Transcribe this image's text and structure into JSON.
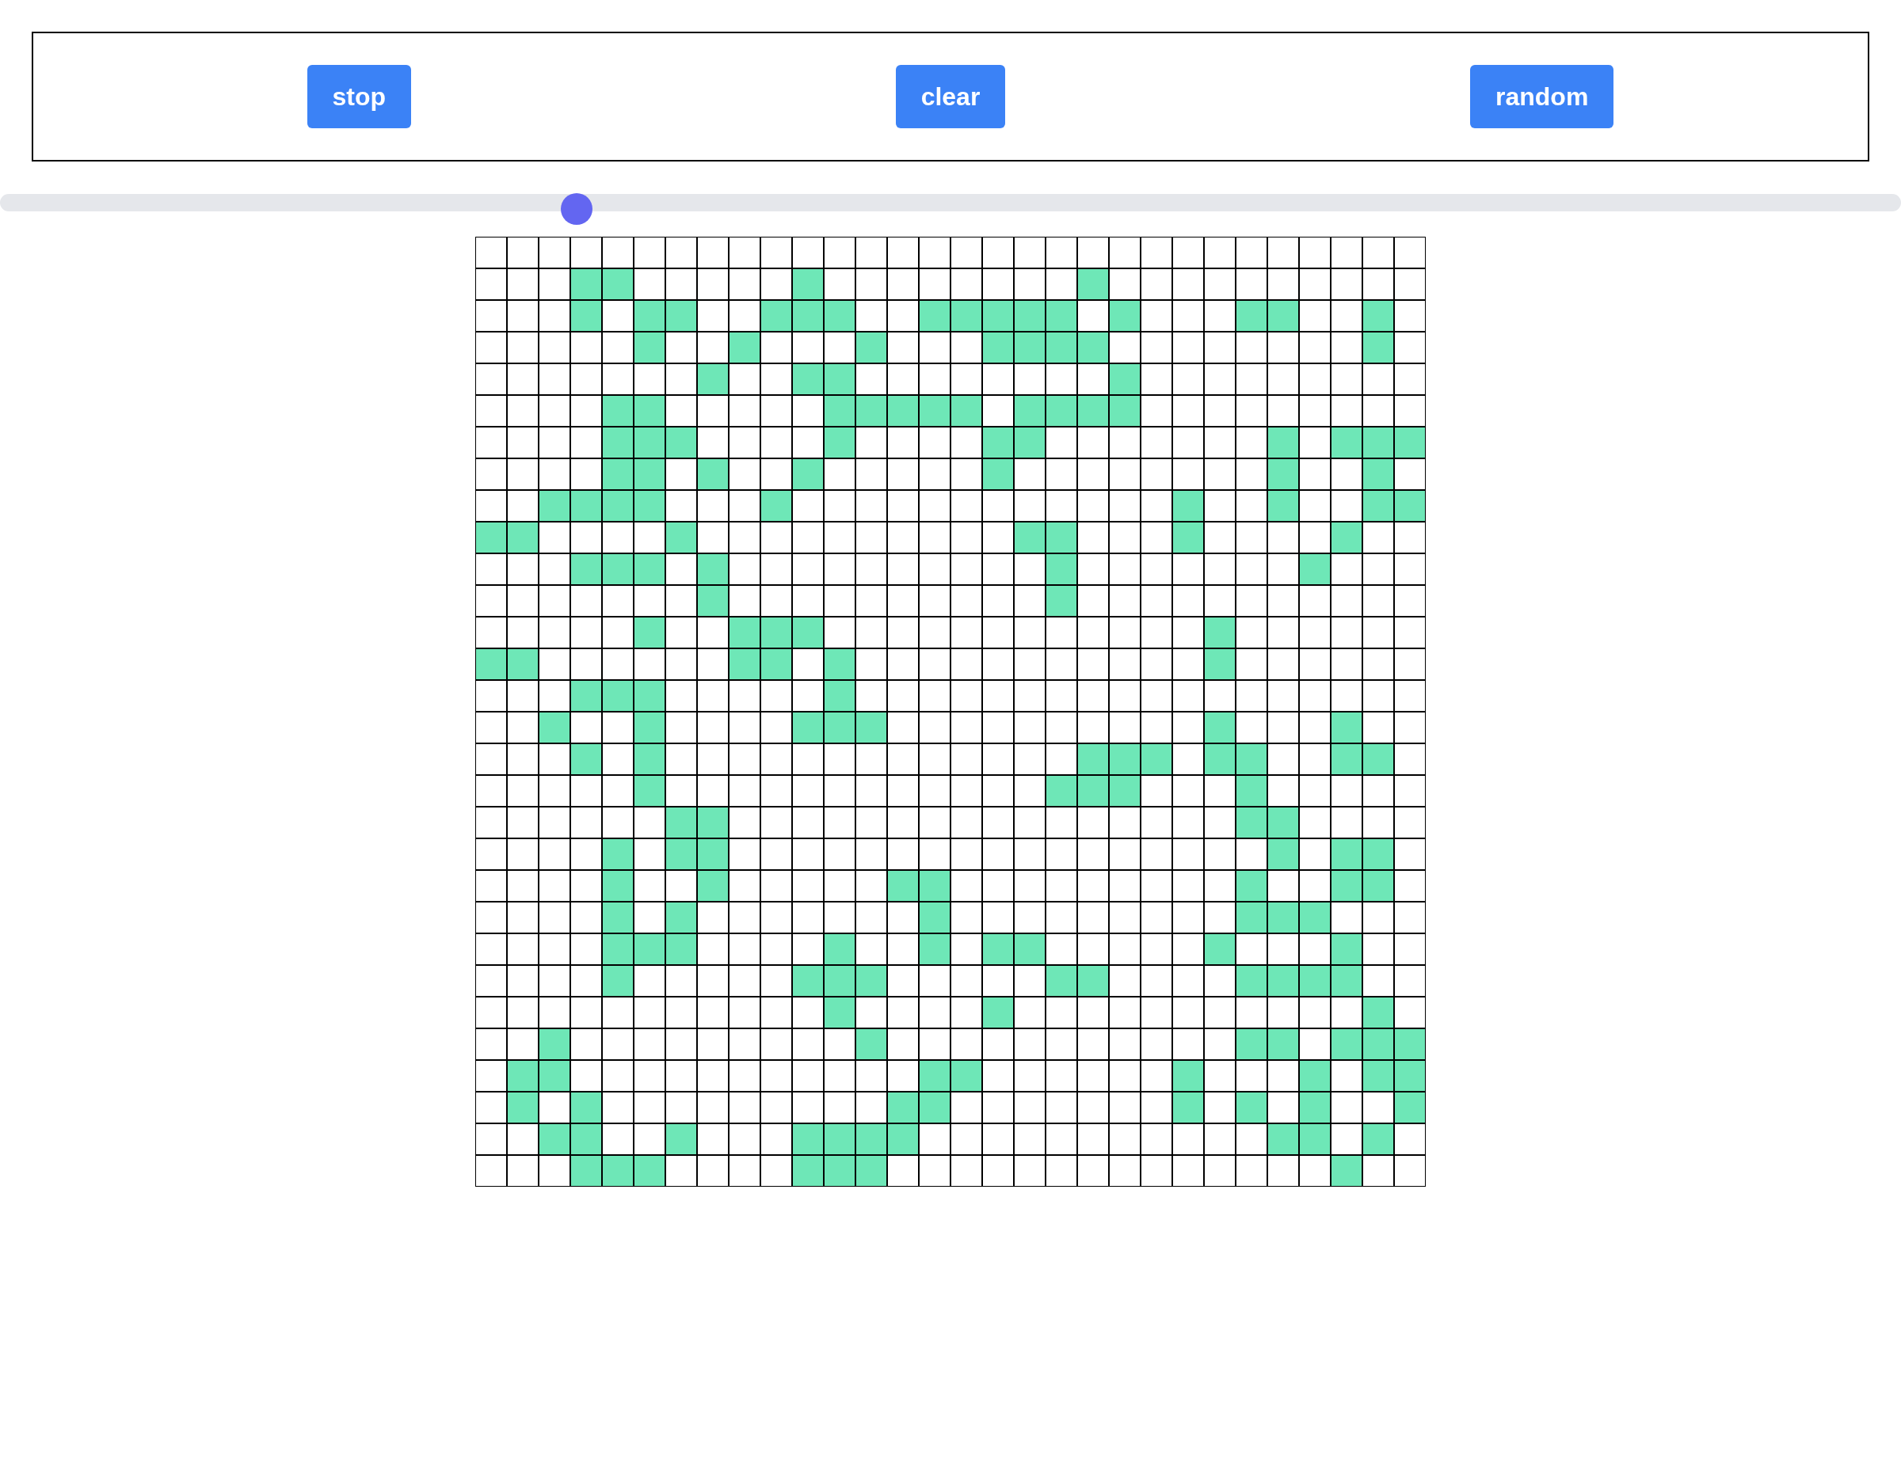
{
  "buttons": [
    {
      "label": "stop"
    },
    {
      "label": "clear"
    },
    {
      "label": "random"
    }
  ],
  "slider": {
    "level": 0.3
  },
  "grid": {
    "alive": [
      [
        false,
        false,
        false,
        false,
        false,
        false,
        false,
        false,
        false,
        false,
        false,
        false,
        false,
        false,
        false,
        false,
        false,
        false,
        false,
        false,
        false,
        false,
        false,
        false,
        false,
        false,
        false,
        false,
        false,
        false
      ],
      [
        false,
        false,
        false,
        true,
        true,
        false,
        false,
        false,
        false,
        false,
        true,
        false,
        false,
        false,
        false,
        false,
        false,
        false,
        false,
        true,
        false,
        false,
        false,
        false,
        false,
        false,
        false,
        false,
        false,
        false
      ],
      [
        false,
        false,
        false,
        true,
        false,
        true,
        true,
        false,
        false,
        true,
        true,
        true,
        false,
        false,
        true,
        true,
        true,
        true,
        true,
        false,
        true,
        false,
        false,
        false,
        true,
        true,
        false,
        false,
        true,
        false
      ],
      [
        false,
        false,
        false,
        false,
        false,
        true,
        false,
        false,
        true,
        false,
        false,
        false,
        true,
        false,
        false,
        false,
        true,
        true,
        true,
        true,
        false,
        false,
        false,
        false,
        false,
        false,
        false,
        false,
        true,
        false
      ],
      [
        false,
        false,
        false,
        false,
        false,
        false,
        false,
        true,
        false,
        false,
        true,
        true,
        false,
        false,
        false,
        false,
        false,
        false,
        false,
        false,
        true,
        false,
        false,
        false,
        false,
        false,
        false,
        false,
        false,
        false
      ],
      [
        false,
        false,
        false,
        false,
        true,
        true,
        false,
        false,
        false,
        false,
        false,
        true,
        true,
        true,
        true,
        true,
        false,
        true,
        true,
        true,
        true,
        false,
        false,
        false,
        false,
        false,
        false,
        false,
        false,
        false
      ],
      [
        false,
        false,
        false,
        false,
        true,
        true,
        true,
        false,
        false,
        false,
        false,
        true,
        false,
        false,
        false,
        false,
        true,
        true,
        false,
        false,
        false,
        false,
        false,
        false,
        false,
        true,
        false,
        true,
        true,
        true
      ],
      [
        false,
        false,
        false,
        false,
        true,
        true,
        false,
        true,
        false,
        false,
        true,
        false,
        false,
        false,
        false,
        false,
        true,
        false,
        false,
        false,
        false,
        false,
        false,
        false,
        false,
        true,
        false,
        false,
        true,
        false
      ],
      [
        false,
        false,
        true,
        true,
        true,
        true,
        false,
        false,
        false,
        true,
        false,
        false,
        false,
        false,
        false,
        false,
        false,
        false,
        false,
        false,
        false,
        false,
        true,
        false,
        false,
        true,
        false,
        false,
        true,
        true
      ],
      [
        true,
        true,
        false,
        false,
        false,
        false,
        true,
        false,
        false,
        false,
        false,
        false,
        false,
        false,
        false,
        false,
        false,
        true,
        true,
        false,
        false,
        false,
        true,
        false,
        false,
        false,
        false,
        true,
        false,
        false
      ],
      [
        false,
        false,
        false,
        true,
        true,
        true,
        false,
        true,
        false,
        false,
        false,
        false,
        false,
        false,
        false,
        false,
        false,
        false,
        true,
        false,
        false,
        false,
        false,
        false,
        false,
        false,
        true,
        false,
        false,
        false
      ],
      [
        false,
        false,
        false,
        false,
        false,
        false,
        false,
        true,
        false,
        false,
        false,
        false,
        false,
        false,
        false,
        false,
        false,
        false,
        true,
        false,
        false,
        false,
        false,
        false,
        false,
        false,
        false,
        false,
        false,
        false
      ],
      [
        false,
        false,
        false,
        false,
        false,
        true,
        false,
        false,
        true,
        true,
        true,
        false,
        false,
        false,
        false,
        false,
        false,
        false,
        false,
        false,
        false,
        false,
        false,
        true,
        false,
        false,
        false,
        false,
        false,
        false
      ],
      [
        true,
        true,
        false,
        false,
        false,
        false,
        false,
        false,
        true,
        true,
        false,
        true,
        false,
        false,
        false,
        false,
        false,
        false,
        false,
        false,
        false,
        false,
        false,
        true,
        false,
        false,
        false,
        false,
        false,
        false
      ],
      [
        false,
        false,
        false,
        true,
        true,
        true,
        false,
        false,
        false,
        false,
        false,
        true,
        false,
        false,
        false,
        false,
        false,
        false,
        false,
        false,
        false,
        false,
        false,
        false,
        false,
        false,
        false,
        false,
        false,
        false
      ],
      [
        false,
        false,
        true,
        false,
        false,
        true,
        false,
        false,
        false,
        false,
        true,
        true,
        true,
        false,
        false,
        false,
        false,
        false,
        false,
        false,
        false,
        false,
        false,
        true,
        false,
        false,
        false,
        true,
        false,
        false
      ],
      [
        false,
        false,
        false,
        true,
        false,
        true,
        false,
        false,
        false,
        false,
        false,
        false,
        false,
        false,
        false,
        false,
        false,
        false,
        false,
        true,
        true,
        true,
        false,
        true,
        true,
        false,
        false,
        true,
        true,
        false
      ],
      [
        false,
        false,
        false,
        false,
        false,
        true,
        false,
        false,
        false,
        false,
        false,
        false,
        false,
        false,
        false,
        false,
        false,
        false,
        true,
        true,
        true,
        false,
        false,
        false,
        true,
        false,
        false,
        false,
        false,
        false
      ],
      [
        false,
        false,
        false,
        false,
        false,
        false,
        true,
        true,
        false,
        false,
        false,
        false,
        false,
        false,
        false,
        false,
        false,
        false,
        false,
        false,
        false,
        false,
        false,
        false,
        true,
        true,
        false,
        false,
        false,
        false
      ],
      [
        false,
        false,
        false,
        false,
        true,
        false,
        true,
        true,
        false,
        false,
        false,
        false,
        false,
        false,
        false,
        false,
        false,
        false,
        false,
        false,
        false,
        false,
        false,
        false,
        false,
        true,
        false,
        true,
        true,
        false
      ],
      [
        false,
        false,
        false,
        false,
        true,
        false,
        false,
        true,
        false,
        false,
        false,
        false,
        false,
        true,
        true,
        false,
        false,
        false,
        false,
        false,
        false,
        false,
        false,
        false,
        true,
        false,
        false,
        true,
        true,
        false
      ],
      [
        false,
        false,
        false,
        false,
        true,
        false,
        true,
        false,
        false,
        false,
        false,
        false,
        false,
        false,
        true,
        false,
        false,
        false,
        false,
        false,
        false,
        false,
        false,
        false,
        true,
        true,
        true,
        false,
        false,
        false
      ],
      [
        false,
        false,
        false,
        false,
        true,
        true,
        true,
        false,
        false,
        false,
        false,
        true,
        false,
        false,
        true,
        false,
        true,
        true,
        false,
        false,
        false,
        false,
        false,
        true,
        false,
        false,
        false,
        true,
        false,
        false
      ],
      [
        false,
        false,
        false,
        false,
        true,
        false,
        false,
        false,
        false,
        false,
        true,
        true,
        true,
        false,
        false,
        false,
        false,
        false,
        true,
        true,
        false,
        false,
        false,
        false,
        true,
        true,
        true,
        true,
        false,
        false
      ],
      [
        false,
        false,
        false,
        false,
        false,
        false,
        false,
        false,
        false,
        false,
        false,
        true,
        false,
        false,
        false,
        false,
        true,
        false,
        false,
        false,
        false,
        false,
        false,
        false,
        false,
        false,
        false,
        false,
        true,
        false
      ],
      [
        false,
        false,
        true,
        false,
        false,
        false,
        false,
        false,
        false,
        false,
        false,
        false,
        true,
        false,
        false,
        false,
        false,
        false,
        false,
        false,
        false,
        false,
        false,
        false,
        true,
        true,
        false,
        true,
        true,
        true
      ],
      [
        false,
        true,
        true,
        false,
        false,
        false,
        false,
        false,
        false,
        false,
        false,
        false,
        false,
        false,
        true,
        true,
        false,
        false,
        false,
        false,
        false,
        false,
        true,
        false,
        false,
        false,
        true,
        false,
        true,
        true
      ],
      [
        false,
        true,
        false,
        true,
        false,
        false,
        false,
        false,
        false,
        false,
        false,
        false,
        false,
        true,
        true,
        false,
        false,
        false,
        false,
        false,
        false,
        false,
        true,
        false,
        true,
        false,
        true,
        false,
        false,
        true
      ],
      [
        false,
        false,
        true,
        true,
        false,
        false,
        true,
        false,
        false,
        false,
        true,
        true,
        true,
        true,
        false,
        false,
        false,
        false,
        false,
        false,
        false,
        false,
        false,
        false,
        false,
        true,
        true,
        false,
        true,
        false
      ],
      [
        false,
        false,
        false,
        true,
        true,
        true,
        false,
        false,
        false,
        false,
        true,
        true,
        true,
        false,
        false,
        false,
        false,
        false,
        false,
        false,
        false,
        false,
        false,
        false,
        false,
        false,
        false,
        true,
        false,
        false
      ]
    ]
  }
}
